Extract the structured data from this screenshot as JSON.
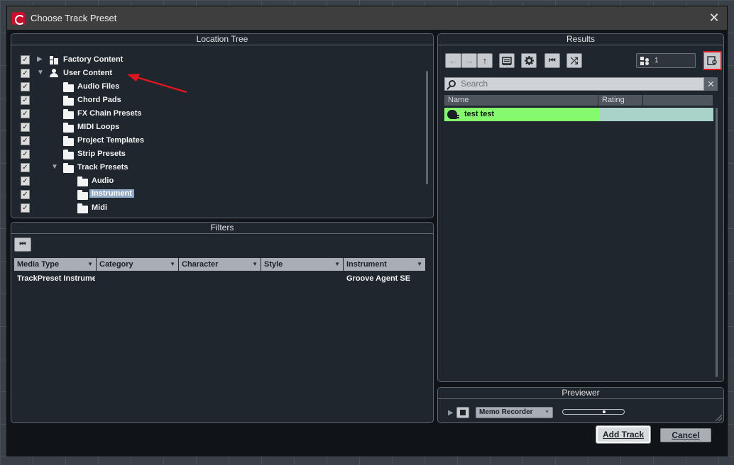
{
  "window": {
    "title": "Choose Track Preset",
    "close_glyph": "✕"
  },
  "location_tree": {
    "header": "Location Tree",
    "items": [
      {
        "label": "Factory Content",
        "icon": "factory-content-icon",
        "expanded": false,
        "checked": true
      },
      {
        "label": "User Content",
        "icon": "user-icon",
        "expanded": true,
        "checked": true
      },
      {
        "label": "Audio Files",
        "icon": "folder-icon",
        "checked": true
      },
      {
        "label": "Chord Pads",
        "icon": "folder-icon",
        "checked": true
      },
      {
        "label": "FX Chain Presets",
        "icon": "folder-icon",
        "checked": true
      },
      {
        "label": "MIDI Loops",
        "icon": "folder-icon",
        "checked": true
      },
      {
        "label": "Project Templates",
        "icon": "folder-icon",
        "checked": true
      },
      {
        "label": "Strip Presets",
        "icon": "folder-icon",
        "checked": true
      },
      {
        "label": "Track Presets",
        "icon": "folder-icon",
        "expanded": true,
        "checked": true
      },
      {
        "label": "Audio",
        "icon": "folder-icon",
        "checked": true
      },
      {
        "label": "Instrument",
        "icon": "folder-icon",
        "checked": true,
        "selected": true
      },
      {
        "label": "Midi",
        "icon": "folder-icon",
        "checked": true
      }
    ]
  },
  "filters": {
    "header": "Filters",
    "reset_glyph": "⏮",
    "columns": [
      {
        "label": "Media Type",
        "value": "TrackPreset Instrument"
      },
      {
        "label": "Category",
        "value": ""
      },
      {
        "label": "Character",
        "value": ""
      },
      {
        "label": "Style",
        "value": ""
      },
      {
        "label": "Instrument",
        "value": "Groove Agent SE"
      }
    ]
  },
  "results": {
    "header": "Results",
    "toolbar": {
      "back_glyph": "←",
      "forward_glyph": "→",
      "up_glyph": "↑",
      "reset_glyph": "⏮",
      "shuffle_glyph": "⤮",
      "count": "1"
    },
    "search": {
      "placeholder": "Search",
      "value": "",
      "clear_glyph": "✕"
    },
    "columns": [
      "Name",
      "Rating",
      ""
    ],
    "rows": [
      {
        "name": "test test",
        "rating": ""
      }
    ]
  },
  "previewer": {
    "header": "Previewer",
    "play_glyph": "▶",
    "memo_recorder": "Memo Recorder",
    "volume_level": 0.68
  },
  "buttons": {
    "add_track": "Add Track",
    "cancel": "Cancel"
  },
  "colors": {
    "result_highlight": "#86fa6e",
    "settings_outline": "#e0161e",
    "selected_item": "#8fa8c4",
    "annotation_arrow": "#e0161e"
  }
}
